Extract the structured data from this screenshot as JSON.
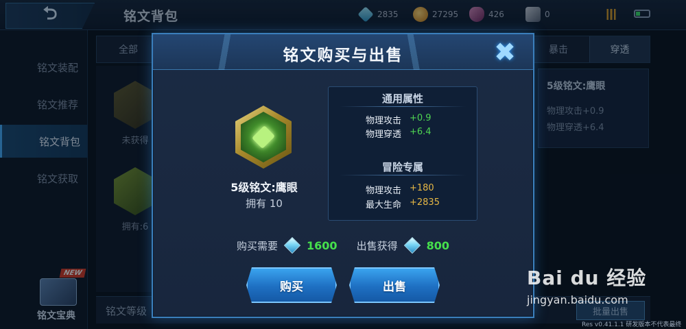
{
  "topbar": {
    "page_title": "铭文背包",
    "currencies": [
      {
        "icon": "gem-icon",
        "value": "2835"
      },
      {
        "icon": "gold-coin-icon",
        "value": "27295"
      },
      {
        "icon": "mask-icon",
        "value": "426"
      },
      {
        "icon": "card-icon",
        "value": "0"
      }
    ]
  },
  "sidebar": {
    "items": [
      {
        "label": "铭文装配"
      },
      {
        "label": "铭文推荐"
      },
      {
        "label": "铭文背包",
        "active": true
      },
      {
        "label": "铭文获取"
      }
    ],
    "new_badge": "NEW",
    "book_label": "铭文宝典"
  },
  "filters": {
    "tabs": [
      "全部",
      "暴击",
      "穿透"
    ],
    "active": "穿透"
  },
  "grid": {
    "cards": [
      {
        "label": "未获得"
      },
      {
        "label": "拥有:6"
      }
    ]
  },
  "detail": {
    "title": "5级铭文:鹰眼",
    "stats": [
      "物理攻击+0.9",
      "物理穿透+6.4"
    ]
  },
  "bottom": {
    "label": "铭文等级",
    "right_button": "批量出售"
  },
  "modal": {
    "title": "铭文购买与出售",
    "rune_name": "5级铭文:鹰眼",
    "owned": "拥有 10",
    "general_attrs": {
      "heading": "通用属性",
      "rows": [
        {
          "key": "物理攻击",
          "value": "+0.9"
        },
        {
          "key": "物理穿透",
          "value": "+6.4"
        }
      ]
    },
    "adventure_attrs": {
      "heading": "冒险专属",
      "rows": [
        {
          "key": "物理攻击",
          "value": "+180"
        },
        {
          "key": "最大生命",
          "value": "+2835"
        }
      ]
    },
    "buy_label": "购买需要",
    "buy_price": "1600",
    "sell_label": "出售获得",
    "sell_price": "800",
    "buy_button": "购买",
    "sell_button": "出售"
  },
  "watermark": {
    "logo": "Bai du 经验",
    "url": "jingyan.baidu.com"
  },
  "version": "Res v0.41.1.1  研发版本不代表最终品质",
  "colors": {
    "accent_blue": "#3b7fbc",
    "value_green": "#4fd552",
    "value_gold": "#e7b845",
    "price_green": "#46e04c"
  }
}
